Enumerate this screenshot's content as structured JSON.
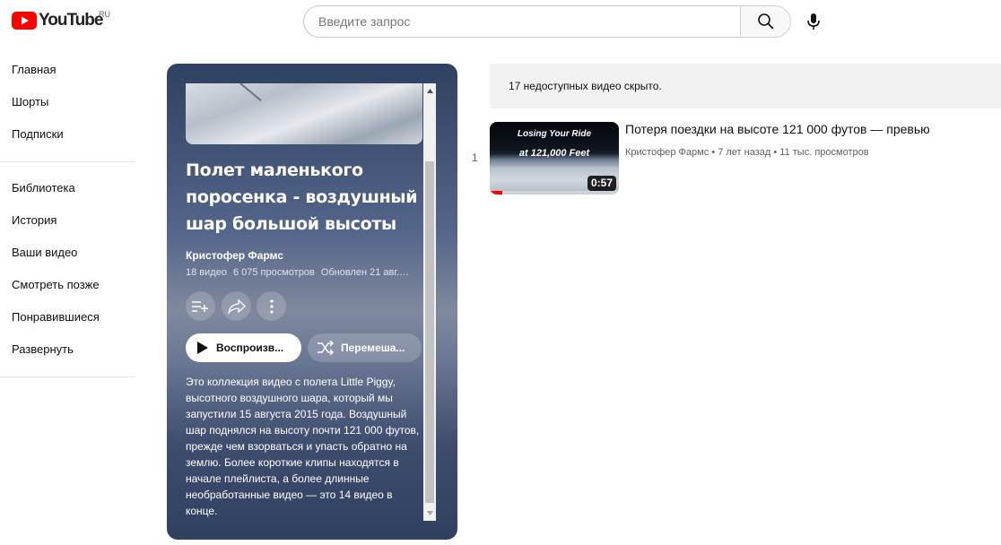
{
  "header": {
    "logo_text": "YouTube",
    "country_code": "RU",
    "search_placeholder": "Введите запрос",
    "search_value": "",
    "icons": [
      "youtube-logo-icon",
      "search-icon",
      "mic-icon"
    ]
  },
  "sidebar": {
    "group1": [
      {
        "label": "Главная"
      },
      {
        "label": "Шорты"
      },
      {
        "label": "Подписки"
      }
    ],
    "group2": [
      {
        "label": "Библиотека"
      },
      {
        "label": "История"
      },
      {
        "label": "Ваши видео"
      },
      {
        "label": "Смотреть позже"
      },
      {
        "label": "Понравившиеся"
      },
      {
        "label": "Развернуть"
      }
    ]
  },
  "playlist": {
    "title": "Полет маленького поросенка - воздушный шар большой высоты",
    "channel": "Кристофер Фармс",
    "video_count": "18 видео",
    "views": "6 075 просмотров",
    "updated": "Обновлен 21 авг...",
    "play_label": "Воспроизв...",
    "shuffle_label": "Перемеша...",
    "description": "Это коллекция видео с полета Little Piggy, высотного воздушного шара, который мы запустили 15 августа 2015 года. Воздушный шар поднялся на высоту почти 121 000 футов, прежде чем взорваться и упасть обратно на землю. Более короткие клипы находятся в начале плейлиста, а более длинные необработанные видео — это 14 видео в конце.",
    "action_icons": [
      "add-to-queue-icon",
      "share-icon",
      "more-vert-icon",
      "play-icon",
      "shuffle-icon"
    ],
    "panel_color": "#3a4a6b"
  },
  "list": {
    "hidden_notice": "17 недоступных видео скрыто.",
    "items": [
      {
        "index": "1",
        "thumb_line1": "Losing Your Ride",
        "thumb_line2": "at 121,000 Feet",
        "duration": "0:57",
        "watched_fraction": 0.1,
        "title": "Потеря поездки на высоте 121 000 футов — превью",
        "channel": "Кристофер Фармс",
        "age": "7 лет назад",
        "views": "11 тыс. просмотров"
      }
    ]
  },
  "colors": {
    "brand_red": "#ff0000",
    "text": "#0f0f0f",
    "secondary_text": "#606060"
  }
}
